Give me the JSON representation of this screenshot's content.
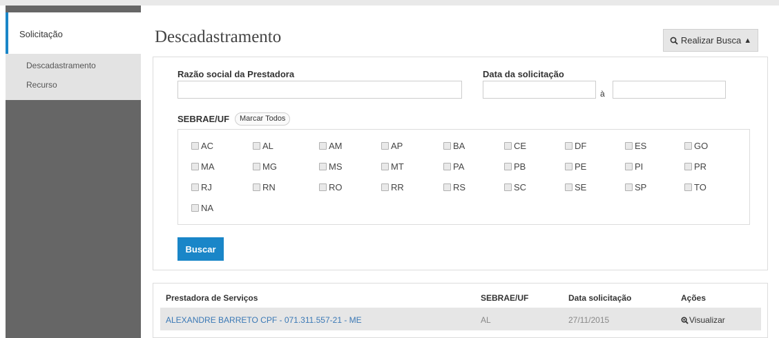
{
  "sidebar": {
    "active_label": "Solicitação",
    "items": [
      {
        "label": "Descadastramento"
      },
      {
        "label": "Recurso"
      }
    ]
  },
  "page": {
    "title": "Descadastramento",
    "search_toggle_label": "Realizar Busca",
    "search_toggle_arrow": "▲"
  },
  "form": {
    "razao_label": "Razão social da Prestadora",
    "razao_value": "",
    "data_label": "Data da solicitação",
    "data_from": "",
    "data_sep": "à",
    "data_to": "",
    "uf_label": "SEBRAE/UF",
    "marcar_todos": "Marcar Todos",
    "ufs": [
      "AC",
      "AL",
      "AM",
      "AP",
      "BA",
      "CE",
      "DF",
      "ES",
      "GO",
      "MA",
      "MG",
      "MS",
      "MT",
      "PA",
      "PB",
      "PE",
      "PI",
      "PR",
      "RJ",
      "RN",
      "RO",
      "RR",
      "RS",
      "SC",
      "SE",
      "SP",
      "TO",
      "NA"
    ],
    "submit_label": "Buscar"
  },
  "results": {
    "headers": [
      "Prestadora de Serviços",
      "SEBRAE/UF",
      "Data solicitação",
      "Ações"
    ],
    "rows": [
      {
        "prestadora": "ALEXANDRE BARRETO CPF - 071.311.557-21 - ME",
        "uf": "AL",
        "data": "27/11/2015",
        "acao": "Visualizar"
      }
    ]
  },
  "colors": {
    "accent": "#1a86c8",
    "sidebar": "#666666",
    "link": "#3a78b5"
  },
  "icons": {
    "search_toggle": "search-icon",
    "view": "zoom-icon"
  }
}
